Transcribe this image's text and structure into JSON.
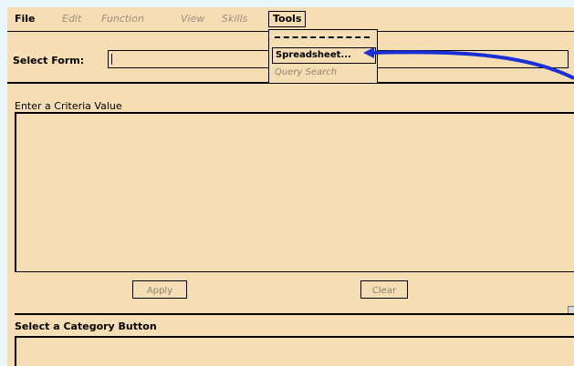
{
  "menubar": {
    "file": "File",
    "edit": "Edit",
    "function": "Function",
    "view": "View",
    "skills": "Skills",
    "tools": "Tools"
  },
  "tools_menu": {
    "items": [
      "Spreadsheet...",
      "Query Search"
    ]
  },
  "select_form": {
    "label": "Select Form:",
    "value": ""
  },
  "criteria": {
    "label": "Enter a Criteria Value",
    "apply_label": "Apply",
    "clear_label": "Clear"
  },
  "category": {
    "label": "Select a Category Button"
  },
  "colors": {
    "window_bg": "#f5deb3",
    "page_bg": "#eaf6fa",
    "annotation_arrow": "#1a2fd6"
  }
}
